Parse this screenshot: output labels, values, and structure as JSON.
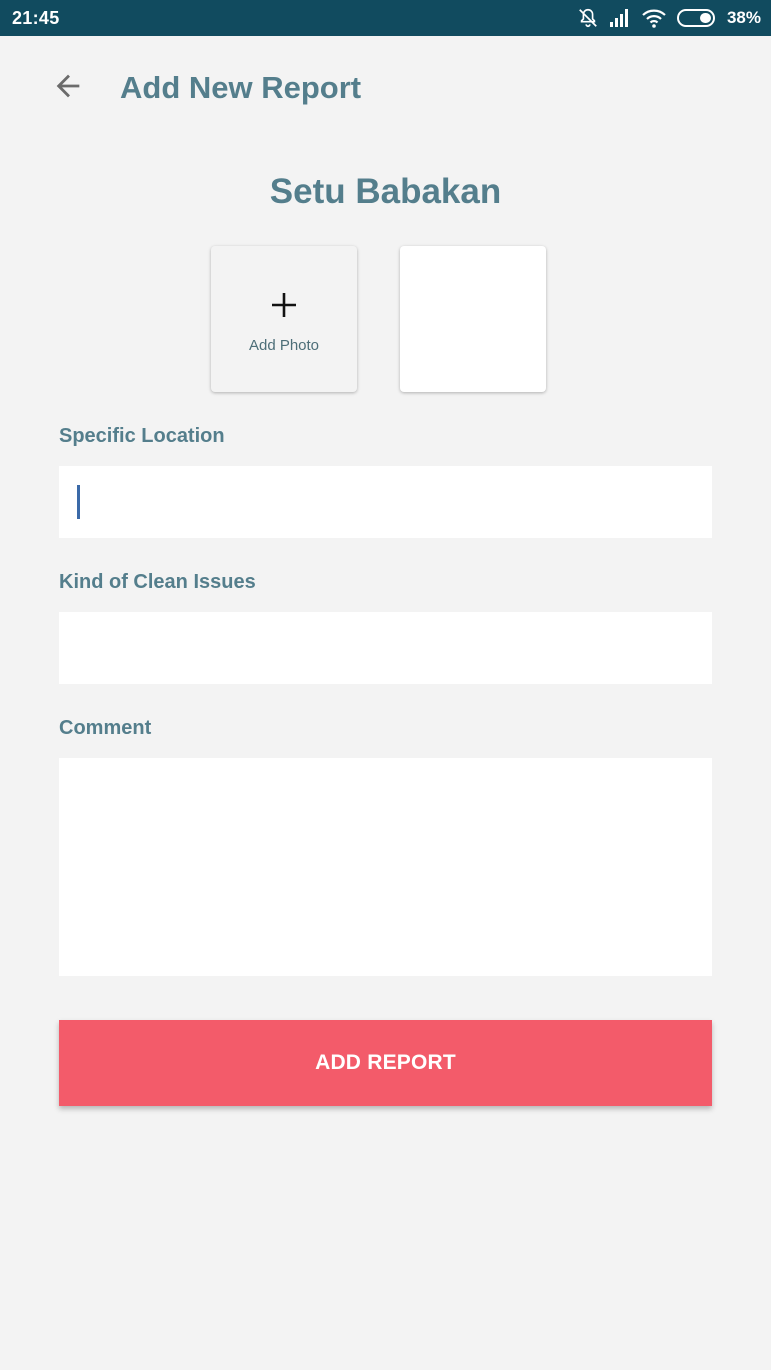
{
  "status_bar": {
    "time": "21:45",
    "battery_percent": "38%",
    "icons": [
      "notifications-off-icon",
      "cellular-signal-icon",
      "wifi-icon",
      "battery-icon"
    ],
    "background_color": "#114b5f"
  },
  "header": {
    "title": "Add New Report",
    "back_icon": "arrow-back-icon"
  },
  "location": {
    "name": "Setu Babakan"
  },
  "photos": {
    "add_label": "Add Photo",
    "add_icon": "plus-icon"
  },
  "form": {
    "specific_location": {
      "label": "Specific Location",
      "value": ""
    },
    "kind_of_issues": {
      "label": "Kind of Clean Issues",
      "value": ""
    },
    "comment": {
      "label": "Comment",
      "value": ""
    }
  },
  "actions": {
    "submit_label": "ADD REPORT",
    "submit_color": "#f35b6a"
  },
  "colors": {
    "title_text": "#547e8c",
    "background": "#f3f3f3"
  }
}
